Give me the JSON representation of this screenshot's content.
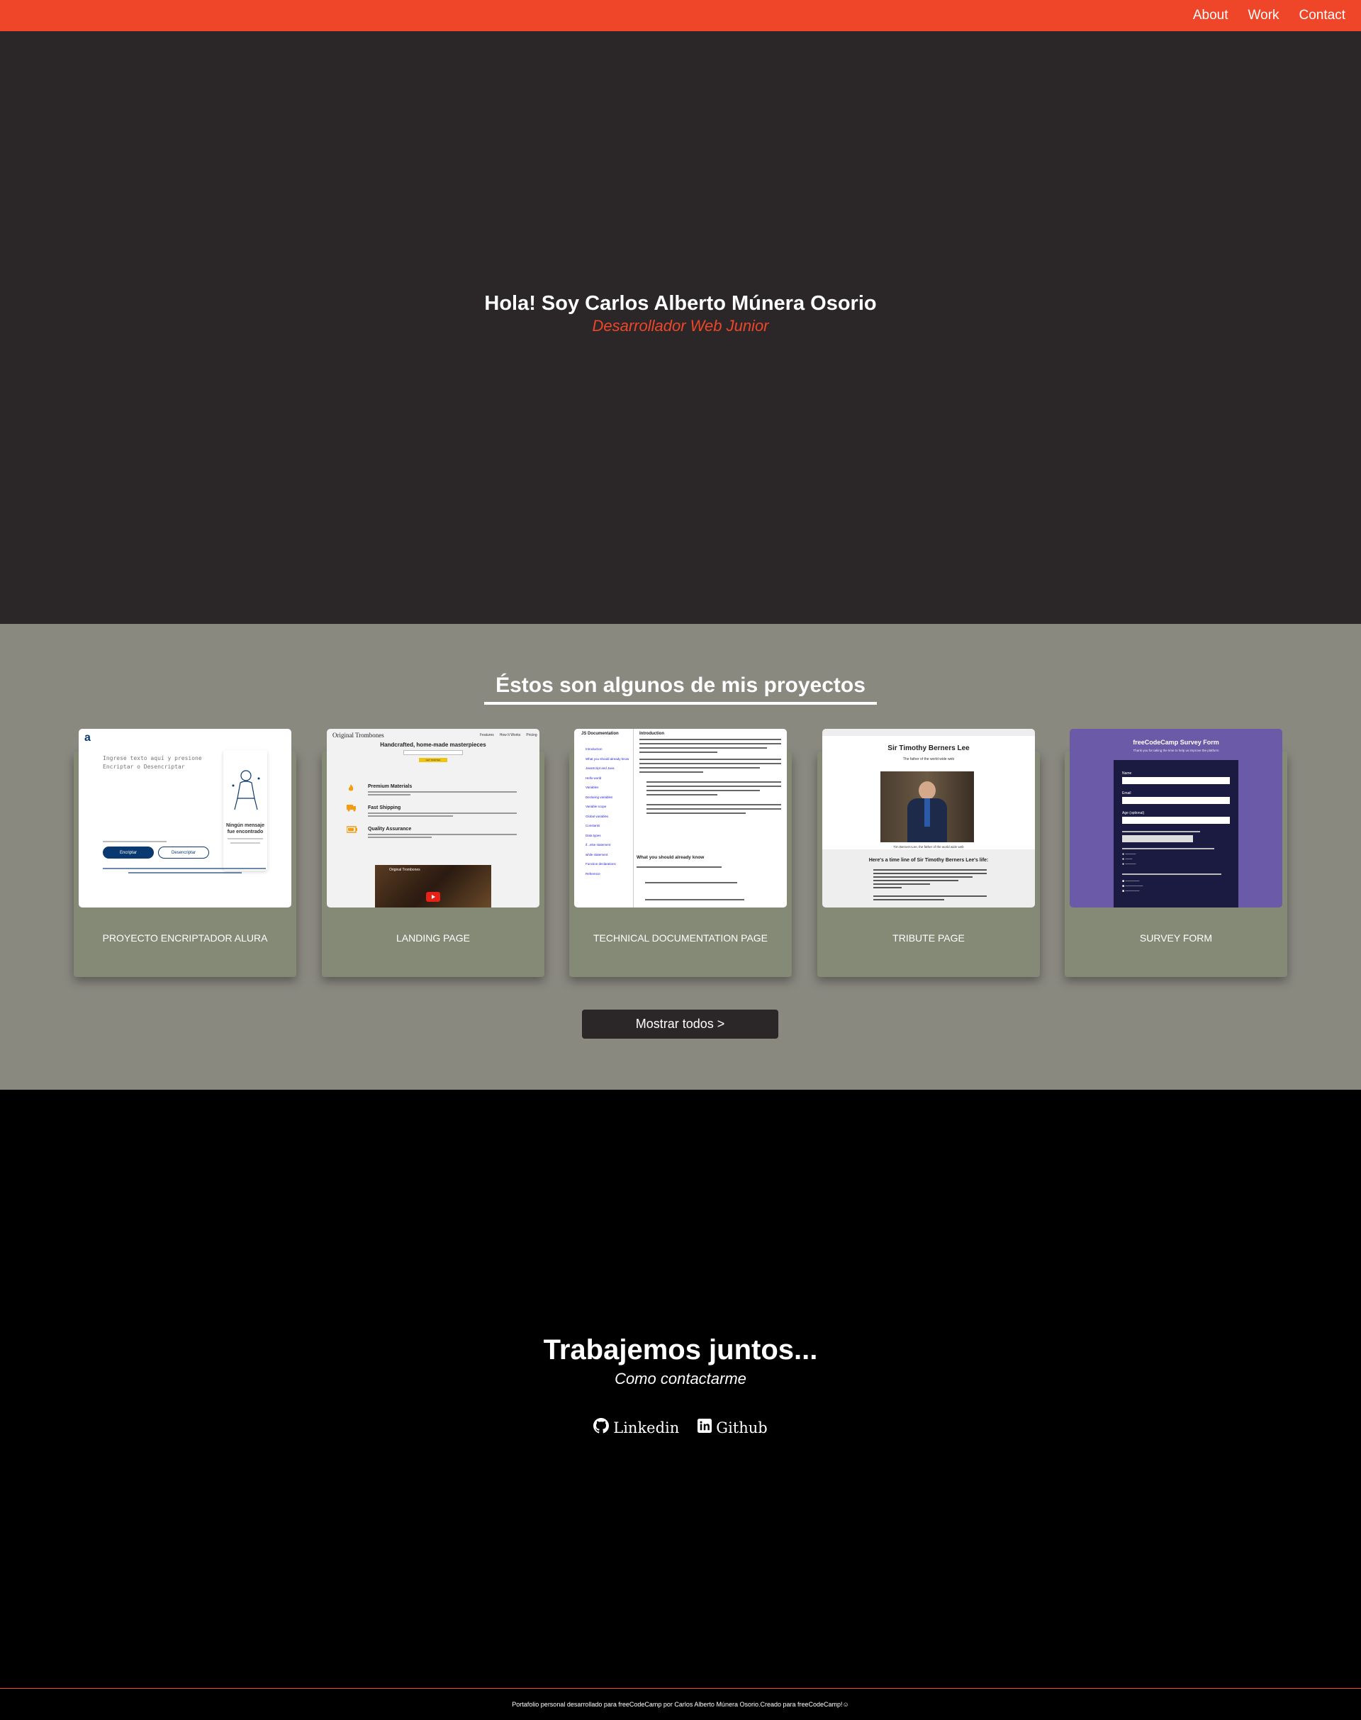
{
  "nav": {
    "links": [
      "About",
      "Work",
      "Contact"
    ]
  },
  "hero": {
    "title": "Hola! Soy Carlos Alberto Múnera Osorio",
    "subtitle": "Desarrollador Web Junior"
  },
  "projects": {
    "heading": "Éstos son algunos de mis proyectos",
    "cards": [
      {
        "label": "PROYECTO ENCRIPTADOR ALURA",
        "thumb": {
          "logo": "a",
          "placeholder": "Ingrese texto aquí y presione Encriptar o Desencriptar",
          "side_title": "Ningún mensaje fue encontrado",
          "btn1": "Encriptar",
          "btn2": "Desencriptar"
        }
      },
      {
        "label": "LANDING PAGE",
        "thumb": {
          "brand": "Original Trombones",
          "nav": [
            "Features",
            "How It Works",
            "Pricing"
          ],
          "headline": "Handcrafted, home-made masterpieces",
          "button": "GET STARTED",
          "features": [
            "Premium Materials",
            "Fast Shipping",
            "Quality Assurance"
          ],
          "video_caption": "Original Trombones"
        }
      },
      {
        "label": "TECHNICAL DOCUMENTATION PAGE",
        "thumb": {
          "sidebar_title": "JS Documentation",
          "sidebar_items": [
            "Introduction",
            "What you should already know",
            "JavaScript and Java",
            "Hello world",
            "Variables",
            "Declaring variables",
            "Variable scope",
            "Global variables",
            "Constants",
            "Data types",
            "if...else statement",
            "while statement",
            "Function declarations",
            "Reference"
          ],
          "main_title": "Introduction",
          "section2": "What you should already know"
        }
      },
      {
        "label": "TRIBUTE PAGE",
        "thumb": {
          "title": "Sir Timothy Berners Lee",
          "tagline": "The father of the world wide web",
          "caption": "Tim Berners-Lee, the father of the world wide web",
          "section": "Here's a time line of Sir Timothy Berners Lee's life:"
        }
      },
      {
        "label": "SURVEY FORM",
        "thumb": {
          "title": "freeCodeCamp Survey Form",
          "desc": "Thank you for taking the time to help us improve the platform",
          "fields": [
            "Name",
            "Email",
            "Age (optional)"
          ]
        }
      }
    ],
    "show_all": "Mostrar todos >"
  },
  "contact": {
    "title": "Trabajemos juntos...",
    "subtitle": "Como contactarme",
    "links": [
      {
        "label": "Linkedin",
        "icon": "github-icon"
      },
      {
        "label": "Github",
        "icon": "linkedin-icon"
      }
    ]
  },
  "footer": {
    "text": "Portafolio personal desarrollado para freeCodeCamp por Carlos Alberto Múnera Osorio.Creado para freeCodeCamp!☺"
  },
  "colors": {
    "accent": "#ef4528",
    "hero_bg": "#2b2728",
    "projects_bg": "#8a8980",
    "card_bg": "#858a76"
  }
}
